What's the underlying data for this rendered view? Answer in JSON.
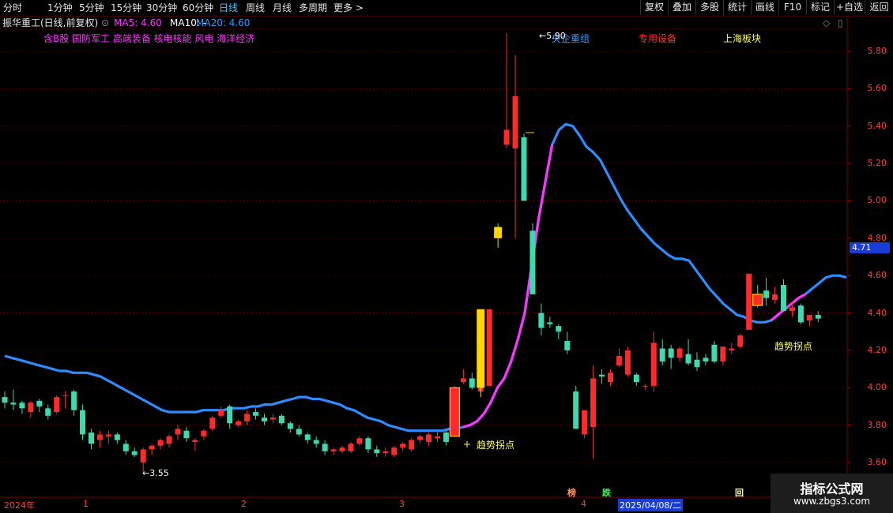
{
  "toolbar": {
    "periods": [
      "分时",
      "1分钟",
      "5分钟",
      "15分钟",
      "30分钟",
      "60分钟",
      "日线",
      "周线",
      "月线",
      "多周期",
      "更多 >"
    ],
    "active": "日线",
    "right_buttons": [
      "复权",
      "叠加",
      "多股",
      "统计",
      "画线",
      "F10",
      "标记",
      "+自选",
      "返回"
    ]
  },
  "infobar": {
    "stock": "振华重工(日线,前复权)",
    "ma5": "MA5: 4.60",
    "ma10": "MA10: -",
    "ma20": "MA20: 4.60",
    "color_ma5": "#ff33ff",
    "color_ma20": "#3399ff"
  },
  "sectors": {
    "tags": "含B股 国防军工 高端装备 核电核能 风电 海洋经济",
    "s1": "央企重组",
    "s2": "专用设备",
    "s3": "上海板块"
  },
  "annotations": {
    "high": "5.90",
    "low": "3.55",
    "turn1": "趋势拐点",
    "turn2": "趋势拐点"
  },
  "last_price": "4.71",
  "events": {
    "e1": "榜",
    "e2": "跌",
    "e3": "回"
  },
  "x_axis": {
    "year": "2024年",
    "m1": "1",
    "m2": "2",
    "m3": "3",
    "m4": "4",
    "date": "2025/04/08/二"
  },
  "watermark": {
    "title": "指标公式网",
    "url": "www.zbgs3.com"
  },
  "chart_data": {
    "type": "candlestick",
    "ylim": [
      3.5,
      5.9
    ],
    "y_ticks": [
      3.6,
      3.8,
      4.0,
      4.2,
      4.4,
      4.6,
      4.8,
      5.0,
      5.2,
      5.4,
      5.6,
      5.8
    ],
    "colors": {
      "up": "#ff2a2a",
      "down": "#3fd9b0",
      "ma_line": "#2f8cff",
      "ma_line_accent": "#ff33ff",
      "signal": "#ffd700"
    },
    "candles": [
      [
        3.95,
        3.98,
        3.89,
        3.92
      ],
      [
        3.92,
        3.99,
        3.88,
        3.91
      ],
      [
        3.92,
        3.93,
        3.86,
        3.89
      ],
      [
        3.87,
        3.93,
        3.84,
        3.92
      ],
      [
        3.93,
        3.94,
        3.87,
        3.9
      ],
      [
        3.89,
        3.91,
        3.83,
        3.85
      ],
      [
        3.87,
        3.96,
        3.86,
        3.95
      ],
      [
        3.96,
        3.98,
        3.89,
        3.96
      ],
      [
        3.98,
        3.99,
        3.85,
        3.88
      ],
      [
        3.88,
        3.91,
        3.72,
        3.75
      ],
      [
        3.76,
        3.78,
        3.67,
        3.7
      ],
      [
        3.72,
        3.77,
        3.68,
        3.75
      ],
      [
        3.74,
        3.77,
        3.7,
        3.75
      ],
      [
        3.75,
        3.76,
        3.7,
        3.72
      ],
      [
        3.7,
        3.72,
        3.64,
        3.66
      ],
      [
        3.66,
        3.68,
        3.63,
        3.64
      ],
      [
        3.6,
        3.68,
        3.55,
        3.67
      ],
      [
        3.67,
        3.7,
        3.64,
        3.69
      ],
      [
        3.69,
        3.73,
        3.67,
        3.72
      ],
      [
        3.7,
        3.75,
        3.68,
        3.74
      ],
      [
        3.75,
        3.8,
        3.72,
        3.78
      ],
      [
        3.77,
        3.79,
        3.71,
        3.73
      ],
      [
        3.71,
        3.73,
        3.66,
        3.72
      ],
      [
        3.74,
        3.78,
        3.72,
        3.77
      ],
      [
        3.78,
        3.85,
        3.77,
        3.84
      ],
      [
        3.85,
        3.9,
        3.84,
        3.88
      ],
      [
        3.9,
        3.91,
        3.78,
        3.81
      ],
      [
        3.8,
        3.83,
        3.79,
        3.82
      ],
      [
        3.82,
        3.88,
        3.8,
        3.86
      ],
      [
        3.87,
        3.89,
        3.83,
        3.85
      ],
      [
        3.84,
        3.86,
        3.8,
        3.82
      ],
      [
        3.83,
        3.86,
        3.81,
        3.84
      ],
      [
        3.85,
        3.86,
        3.8,
        3.81
      ],
      [
        3.81,
        3.82,
        3.76,
        3.78
      ],
      [
        3.78,
        3.8,
        3.74,
        3.75
      ],
      [
        3.75,
        3.76,
        3.7,
        3.72
      ],
      [
        3.72,
        3.74,
        3.68,
        3.7
      ],
      [
        3.7,
        3.72,
        3.64,
        3.66
      ],
      [
        3.66,
        3.68,
        3.64,
        3.67
      ],
      [
        3.66,
        3.69,
        3.65,
        3.68
      ],
      [
        3.66,
        3.71,
        3.65,
        3.7
      ],
      [
        3.7,
        3.74,
        3.69,
        3.73
      ],
      [
        3.73,
        3.74,
        3.65,
        3.67
      ],
      [
        3.67,
        3.69,
        3.63,
        3.65
      ],
      [
        3.65,
        3.68,
        3.63,
        3.66
      ],
      [
        3.64,
        3.69,
        3.63,
        3.68
      ],
      [
        3.68,
        3.71,
        3.66,
        3.7
      ],
      [
        3.67,
        3.73,
        3.66,
        3.72
      ],
      [
        3.72,
        3.75,
        3.7,
        3.74
      ],
      [
        3.71,
        3.76,
        3.69,
        3.75
      ],
      [
        3.73,
        3.77,
        3.71,
        3.74
      ],
      [
        3.76,
        3.77,
        3.69,
        3.71
      ],
      [
        3.74,
        4.01,
        3.74,
        4.0
      ],
      [
        4.03,
        4.1,
        4.02,
        4.05
      ],
      [
        4.05,
        4.08,
        3.99,
        4.0
      ],
      [
        3.98,
        4.02,
        3.97,
        4.01
      ],
      [
        4.01,
        4.42,
        4.01,
        4.42
      ],
      [
        4.86,
        4.88,
        4.8,
        4.84
      ],
      [
        5.3,
        5.9,
        5.28,
        5.38
      ],
      [
        5.28,
        5.78,
        4.8,
        5.56
      ],
      [
        5.34,
        5.36,
        5.0,
        5.0
      ],
      [
        4.84,
        4.88,
        4.5,
        4.5
      ],
      [
        4.4,
        4.45,
        4.28,
        4.32
      ],
      [
        4.35,
        4.38,
        4.32,
        4.34
      ],
      [
        4.33,
        4.34,
        4.26,
        4.3
      ],
      [
        4.25,
        4.3,
        4.18,
        4.2
      ],
      [
        3.98,
        4.01,
        3.78,
        3.78
      ],
      [
        3.75,
        3.82,
        3.73,
        3.88
      ],
      [
        3.79,
        4.12,
        3.62,
        4.05
      ],
      [
        4.07,
        4.1,
        4.02,
        4.06
      ],
      [
        4.03,
        4.1,
        4.01,
        4.08
      ],
      [
        4.12,
        4.21,
        4.11,
        4.17
      ],
      [
        4.07,
        4.22,
        4.06,
        4.2
      ],
      [
        4.07,
        4.08,
        4.01,
        4.03
      ],
      [
        4.01,
        4.02,
        3.99,
        4.01
      ],
      [
        4.01,
        4.3,
        3.98,
        4.24
      ],
      [
        4.21,
        4.26,
        4.12,
        4.14
      ],
      [
        4.21,
        4.23,
        4.1,
        4.16
      ],
      [
        4.16,
        4.22,
        4.14,
        4.21
      ],
      [
        4.18,
        4.26,
        4.12,
        4.13
      ],
      [
        4.15,
        4.19,
        4.09,
        4.11
      ],
      [
        4.16,
        4.18,
        4.12,
        4.14
      ],
      [
        4.23,
        4.25,
        4.13,
        4.14
      ],
      [
        4.14,
        4.18,
        4.12,
        4.22
      ],
      [
        4.2,
        4.24,
        4.18,
        4.21
      ],
      [
        4.22,
        4.29,
        4.21,
        4.28
      ],
      [
        4.31,
        4.61,
        4.31,
        4.61
      ],
      [
        4.5,
        4.55,
        4.43,
        4.44
      ],
      [
        4.52,
        4.59,
        4.44,
        4.48
      ],
      [
        4.47,
        4.54,
        4.45,
        4.5
      ],
      [
        4.55,
        4.58,
        4.41,
        4.41
      ],
      [
        4.41,
        4.46,
        4.38,
        4.43
      ],
      [
        4.44,
        4.45,
        4.34,
        4.35
      ],
      [
        4.36,
        4.39,
        4.33,
        4.39
      ],
      [
        4.39,
        4.41,
        4.35,
        4.37
      ]
    ],
    "ma_line": [
      4.17,
      4.16,
      4.15,
      4.14,
      4.13,
      4.12,
      4.11,
      4.1,
      4.09,
      4.09,
      4.08,
      4.08,
      4.08,
      4.07,
      4.06,
      4.04,
      4.02,
      4.0,
      3.98,
      3.96,
      3.94,
      3.92,
      3.9,
      3.88,
      3.87,
      3.87,
      3.87,
      3.87,
      3.87,
      3.88,
      3.88,
      3.88,
      3.88,
      3.89,
      3.89,
      3.89,
      3.9,
      3.9,
      3.91,
      3.91,
      3.92,
      3.93,
      3.94,
      3.95,
      3.95,
      3.94,
      3.94,
      3.93,
      3.92,
      3.91,
      3.89,
      3.88,
      3.86,
      3.84,
      3.83,
      3.82,
      3.8,
      3.79,
      3.78,
      3.77,
      3.77,
      3.77,
      3.77,
      3.77,
      3.77,
      3.78,
      3.78,
      3.79,
      3.8,
      3.82,
      3.86,
      3.92,
      4.0,
      4.05,
      4.14,
      4.26,
      4.4,
      4.65,
      4.9,
      5.1,
      5.3,
      5.38,
      5.41,
      5.4,
      5.35,
      5.29,
      5.26,
      5.22,
      5.15,
      5.08,
      5.01,
      4.95,
      4.9,
      4.85,
      4.81,
      4.77,
      4.74,
      4.71,
      4.69,
      4.69,
      4.68,
      4.63,
      4.58,
      4.53,
      4.49,
      4.45,
      4.42,
      4.39,
      4.38,
      4.36,
      4.35,
      4.35,
      4.36,
      4.39,
      4.42,
      4.45,
      4.48,
      4.5,
      4.53,
      4.56,
      4.59,
      4.6,
      4.6,
      4.59
    ],
    "signals": [
      {
        "index": 52,
        "label": "趋势拐点"
      },
      {
        "index": 87,
        "label": "趋势拐点"
      }
    ],
    "yellow_bars": [
      [
        55,
        4.42,
        4.0
      ],
      [
        57,
        4.86,
        4.8
      ]
    ]
  }
}
